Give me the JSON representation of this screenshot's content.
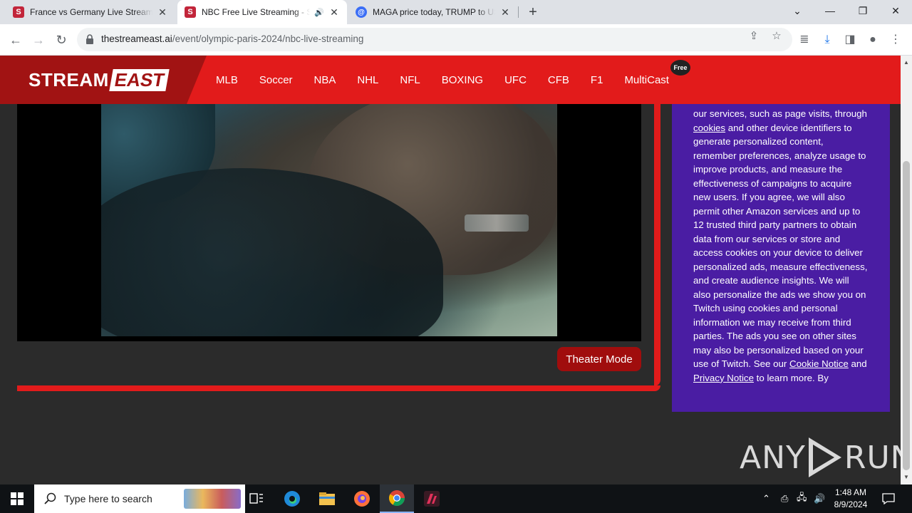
{
  "browser": {
    "tabs": [
      {
        "title": "France vs Germany Live Streamin",
        "favicon": "S",
        "active": false
      },
      {
        "title": "NBC Free Live Streaming - S",
        "favicon": "S",
        "active": true,
        "audio": true
      },
      {
        "title": "MAGA price today, TRUMP to US",
        "favicon": "@",
        "active": false
      }
    ],
    "url_host": "thestreameast.ai",
    "url_path": "/event/olympic-paris-2024/nbc-live-streaming"
  },
  "site": {
    "logo_left": "STREAM",
    "logo_right": "EAST",
    "nav": [
      "MLB",
      "Soccer",
      "NBA",
      "NHL",
      "NFL",
      "BOXING",
      "UFC",
      "CFB",
      "F1",
      "MultiCast"
    ],
    "free_badge": "Free",
    "theater_button": "Theater Mode",
    "colors": {
      "header": "#e21b1b",
      "logo_bg": "#a11313",
      "consent_bg": "#4a1da3",
      "page_bg": "#2b2b2b"
    }
  },
  "consent": {
    "p1": "our services, such as page visits, through ",
    "link_cookies": "cookies",
    "p2": " and other device identifiers to generate personalized content, remember preferences, analyze usage to improve products, and measure the effectiveness of campaigns to acquire new users. If you agree, we will also permit other Amazon services and up to 12 trusted third party partners to obtain data from our services or store and access cookies on your device to deliver personalized ads, measure effectiveness, and create audience insights. We will also personalize the ads we show you on Twitch using cookies and personal information we may receive from third parties. The ads you see on other sites may also be personalized based on your use of Twitch. See our ",
    "link_cookie_notice": "Cookie Notice",
    "p3": " and ",
    "link_privacy": "Privacy Notice",
    "p4": " to learn more. By"
  },
  "watermark": {
    "left": "ANY",
    "right": "RUN"
  },
  "taskbar": {
    "search_placeholder": "Type here to search",
    "time": "1:48 AM",
    "date": "8/9/2024"
  }
}
